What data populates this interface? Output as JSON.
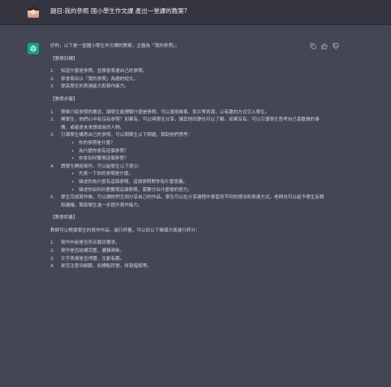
{
  "user": {
    "message": "題目:我的參照 國小學生作文課 產出一堂課的教案?"
  },
  "assistant": {
    "intro": "好的，以下是一堂國小學生作文課的教案，主題為「我的參照」。",
    "sections": [
      {
        "heading": "【教學目標】",
        "items": [
          {
            "n": "1.",
            "text": "知道什麼是參照，並學會表達自己的參照。"
          },
          {
            "n": "2.",
            "text": "學會寫出以「我的參照」為題的短文。"
          },
          {
            "n": "3.",
            "text": "提高學生的表達能力和寫作能力。"
          }
        ]
      },
      {
        "heading": "【教學步驟】",
        "items": [
          {
            "n": "1.",
            "text": "簡單介紹參照的概念，讓學生能理解什麼是參照。可以運用故事、影片等資源，以有趣的方式引入學生。"
          },
          {
            "n": "2.",
            "text": "開學生，他們心中有沒有參照？如果有，可以與學生分享，讓其他同學也可以了解。如果沒有，可以引導學生思考自己喜歡做的事情，或者是未來想成為的人物。"
          },
          {
            "n": "3.",
            "text": "引導學生構思自己的參照，可以問學生以下問題，幫助他們思考：",
            "bullets": [
              "你的參照是什麼？",
              "為什麼你會有這個參照？",
              "你會如何實現這個參照？"
            ]
          },
          {
            "n": "4.",
            "text": "請學生開始寫作，可以給學生以下提示：",
            "bullets": [
              "先寫一下你的參照是什麼。",
              "描述你為什麼有這個參照，這個參照對你有什麼意義。",
              "描述你如何計劃實現這個參照，需要付出什麼樣的努力。"
            ]
          },
          {
            "n": "5.",
            "text": "學生完成寫作後，可以讓他們互相分享自己的作品，學生可以在分享過程中學習到不同的想法和表達方式。老師也可以給予學生反饋和建議，幫助學生進一步提升寫作能力。"
          }
        ]
      },
      {
        "heading": "【教學評量】",
        "intro": "教師可以根據學生的寫作作品，進行評量，可以從以下幾個方面進行評分：",
        "items": [
          {
            "n": "1.",
            "text": "寫作內容是否符合題目要求。"
          },
          {
            "n": "2.",
            "text": "寫作是否結構完整，邏輯清晰。"
          },
          {
            "n": "3.",
            "text": "文字表達是否得體，生動有趣。"
          },
          {
            "n": "4.",
            "text": "是否注意到細節，如標點符號，拼寫錯誤等。"
          }
        ]
      }
    ]
  },
  "icons": {
    "copy": "copy-icon",
    "thumbs_up": "thumbs-up-icon",
    "thumbs_down": "thumbs-down-icon",
    "brand": "openai-logo-icon"
  },
  "colors": {
    "page_bg": "#444654",
    "user_row_bg": "#343541",
    "gpt_avatar": "#10a37f",
    "text": "#d1d5db"
  }
}
